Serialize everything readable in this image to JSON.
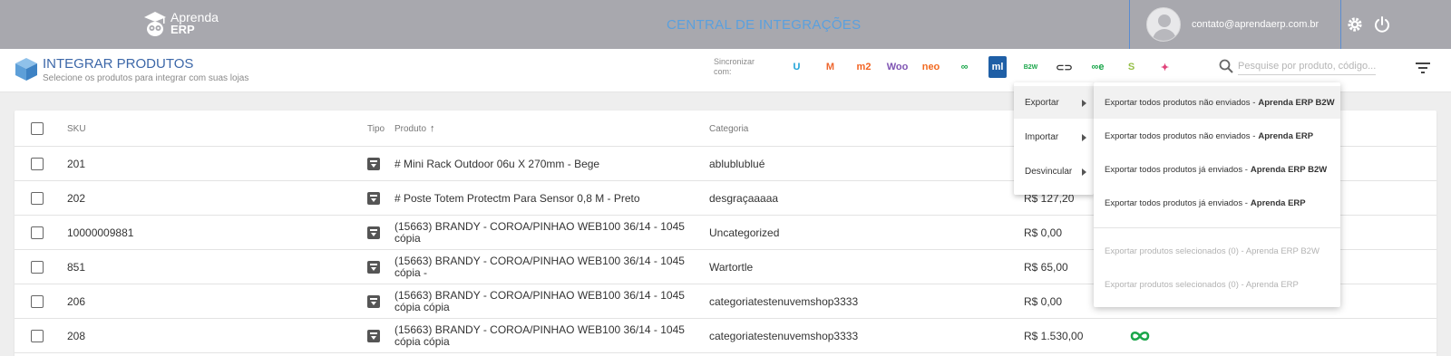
{
  "topbar": {
    "logo_line1": "Aprenda",
    "logo_line2": "ERP",
    "central_title": "CENTRAL DE INTEGRAÇÕES",
    "user_email": "contato@aprendaerp.com.br"
  },
  "subheader": {
    "title": "INTEGRAR PRODUTOS",
    "subtitle": "Selecione os produtos para integrar com suas lojas",
    "sync_label": "Sincronizar com:",
    "sync_icons": [
      {
        "name": "uol-icon",
        "text": "U",
        "color": "#1fa3d8"
      },
      {
        "name": "magento-icon",
        "text": "M",
        "color": "#ee672f"
      },
      {
        "name": "magento2-icon",
        "text": "m2",
        "color": "#f26322"
      },
      {
        "name": "woo-icon",
        "text": "Woo",
        "color": "#7f54b3"
      },
      {
        "name": "neo-icon",
        "text": "neo",
        "color": "#f26a21"
      },
      {
        "name": "infinity-icon",
        "text": "∞",
        "color": "#1aa64a"
      },
      {
        "name": "mercadolivre-icon",
        "text": "ml",
        "color": "#1f5fa6"
      },
      {
        "name": "b2w-icon",
        "text": "B2W",
        "color": "#1aa64a"
      },
      {
        "name": "link-icon",
        "text": "⊂⊃",
        "color": "#333333"
      },
      {
        "name": "omnichannel-icon",
        "text": "∞e",
        "color": "#1aa64a"
      },
      {
        "name": "shopify-icon",
        "text": "S",
        "color": "#95bf47"
      },
      {
        "name": "star-icon",
        "text": "✦",
        "color": "#e0447b"
      }
    ],
    "search_placeholder": "Pesquise por produto, código..."
  },
  "table": {
    "headers": {
      "sku": "SKU",
      "tipo": "Tipo",
      "produto": "Produto",
      "categoria": "Categoria"
    },
    "rows": [
      {
        "sku": "201",
        "produto": "# Mini Rack Outdoor 06u X 270mm - Bege",
        "categoria": "ablublublué",
        "preco": ""
      },
      {
        "sku": "202",
        "produto": "# Poste Totem Protectm Para Sensor 0,8 M - Preto",
        "categoria": "desgraçaaaaa",
        "preco": "R$ 127,20"
      },
      {
        "sku": "10000009881",
        "produto": "(15663) BRANDY - COROA/PINHAO WEB100 36/14 - 1045 cópia",
        "categoria": "Uncategorized",
        "preco": "R$ 0,00"
      },
      {
        "sku": "851",
        "produto": "(15663) BRANDY - COROA/PINHAO WEB100 36/14 - 1045 cópia -",
        "categoria": "Wartortle",
        "preco": "R$ 65,00"
      },
      {
        "sku": "206",
        "produto": "(15663) BRANDY - COROA/PINHAO WEB100 36/14 - 1045 cópia cópia",
        "categoria": "categoriatestenuvemshop3333",
        "preco": "R$ 0,00"
      },
      {
        "sku": "208",
        "produto": "(15663) BRANDY - COROA/PINHAO WEB100 36/14 - 1045 cópia cópia",
        "categoria": "categoriatestenuvemshop3333",
        "preco": "R$ 1.530,00"
      }
    ]
  },
  "menu": {
    "items": [
      "Exportar",
      "Importar",
      "Desvincular"
    ],
    "submenu": [
      {
        "text": "Exportar todos produtos não enviados -",
        "bold": "Aprenda ERP B2W"
      },
      {
        "text": "Exportar todos produtos não enviados -",
        "bold": "Aprenda ERP"
      },
      {
        "text": "Exportar todos produtos já enviados -",
        "bold": "Aprenda ERP B2W"
      },
      {
        "text": "Exportar todos produtos já enviados -",
        "bold": "Aprenda ERP"
      },
      {
        "text": "Exportar produtos selecionados (0) - Aprenda ERP B2W",
        "bold": ""
      },
      {
        "text": "Exportar produtos selecionados (0) - Aprenda ERP",
        "bold": ""
      }
    ]
  }
}
